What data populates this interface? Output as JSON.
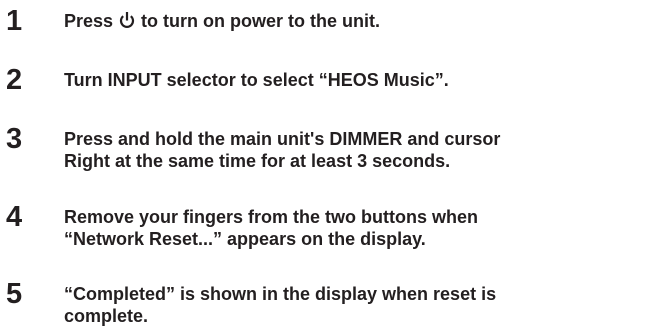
{
  "steps": [
    {
      "number": "1",
      "text_before": "Press ",
      "icon": "power-icon",
      "text_after": " to turn on power to the unit."
    },
    {
      "number": "2",
      "text": "Turn INPUT selector to select “HEOS Music”."
    },
    {
      "number": "3",
      "line1": "Press and hold the main unit's DIMMER and cursor",
      "line2": "Right at the same time for at least 3 seconds."
    },
    {
      "number": "4",
      "line1": "Remove your fingers from the two buttons when",
      "line2": "“Network Reset...” appears on the display."
    },
    {
      "number": "5",
      "line1": "“Completed” is shown in the display when reset is",
      "line2": "complete."
    }
  ],
  "colors": {
    "text": "#231f20",
    "background": "#ffffff"
  }
}
